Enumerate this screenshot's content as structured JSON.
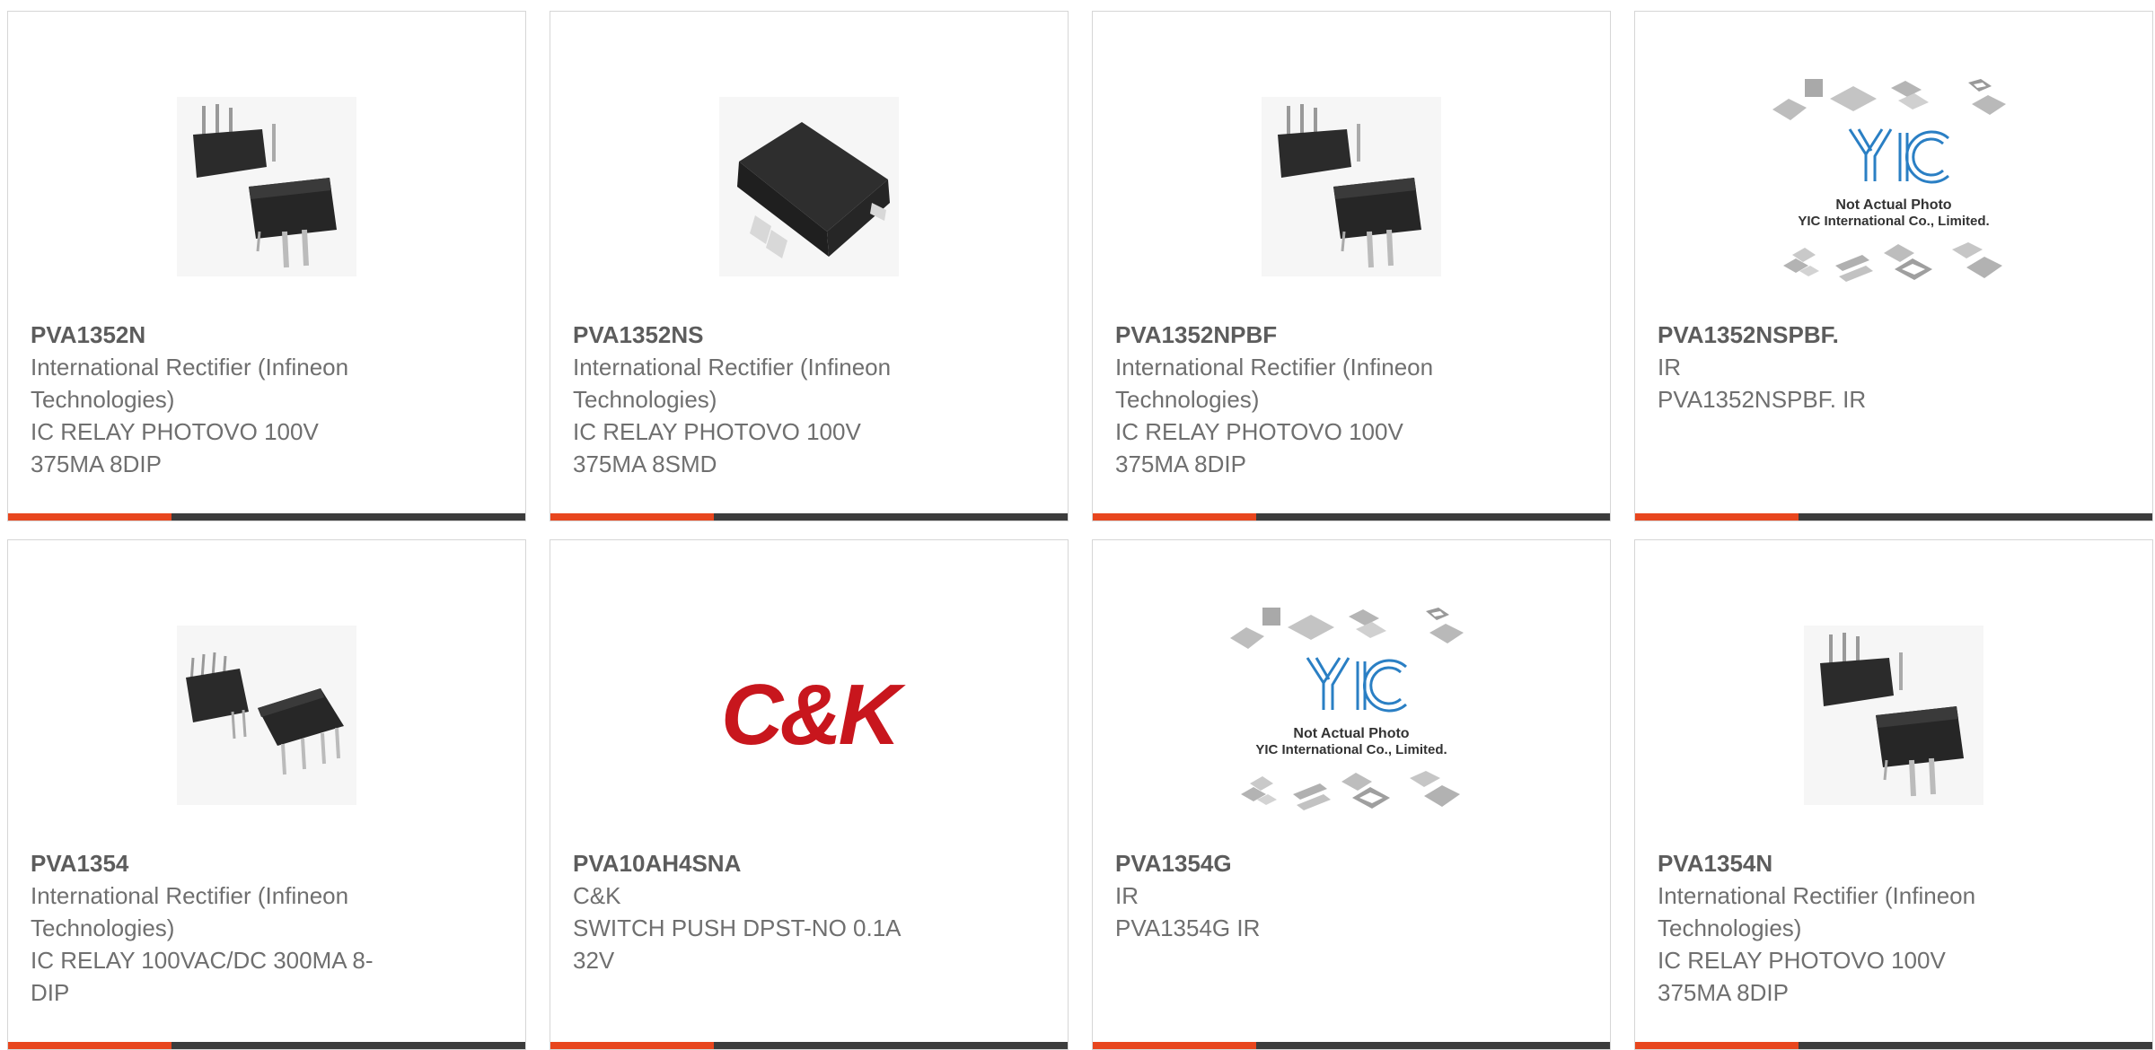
{
  "colors": {
    "accent": "#e8461e",
    "bar": "#3c3c3c",
    "text": "#6f6f6f",
    "yic_blue": "#2a7fc4",
    "ck_red": "#c8161d"
  },
  "products": [
    {
      "part": "PVA1352N",
      "manufacturer": "International Rectifier (Infineon Technologies)",
      "description": "IC RELAY PHOTOVO 100V 375MA 8DIP",
      "image": "dip-relay-photo"
    },
    {
      "part": "PVA1352NS",
      "manufacturer": "International Rectifier (Infineon Technologies)",
      "description": "IC RELAY PHOTOVO 100V 375MA 8SMD",
      "image": "smd-relay-photo"
    },
    {
      "part": "PVA1352NPBF",
      "manufacturer": "International Rectifier (Infineon Technologies)",
      "description": "IC RELAY PHOTOVO 100V 375MA 8DIP",
      "image": "dip-relay-photo"
    },
    {
      "part": "PVA1352NSPBF.",
      "manufacturer": "IR",
      "description": "PVA1352NSPBF. IR",
      "image": "yic-placeholder",
      "placeholder_line1": "Not Actual Photo",
      "placeholder_line2": "YIC International Co., Limited."
    },
    {
      "part": "PVA1354",
      "manufacturer": "International Rectifier (Infineon Technologies)",
      "description": "IC RELAY 100VAC/DC 300MA 8-DIP",
      "image": "dip8-photo"
    },
    {
      "part": "PVA10AH4SNA",
      "manufacturer": "C&K",
      "description": "SWITCH PUSH DPST-NO 0.1A 32V",
      "image": "ck-logo",
      "logo_text": "C&K"
    },
    {
      "part": "PVA1354G",
      "manufacturer": "IR",
      "description": "PVA1354G IR",
      "image": "yic-placeholder",
      "placeholder_line1": "Not Actual Photo",
      "placeholder_line2": "YIC International Co., Limited."
    },
    {
      "part": "PVA1354N",
      "manufacturer": "International Rectifier (Infineon Technologies)",
      "description": "IC RELAY PHOTOVO 100V 375MA 8DIP",
      "image": "dip-relay-photo"
    }
  ]
}
